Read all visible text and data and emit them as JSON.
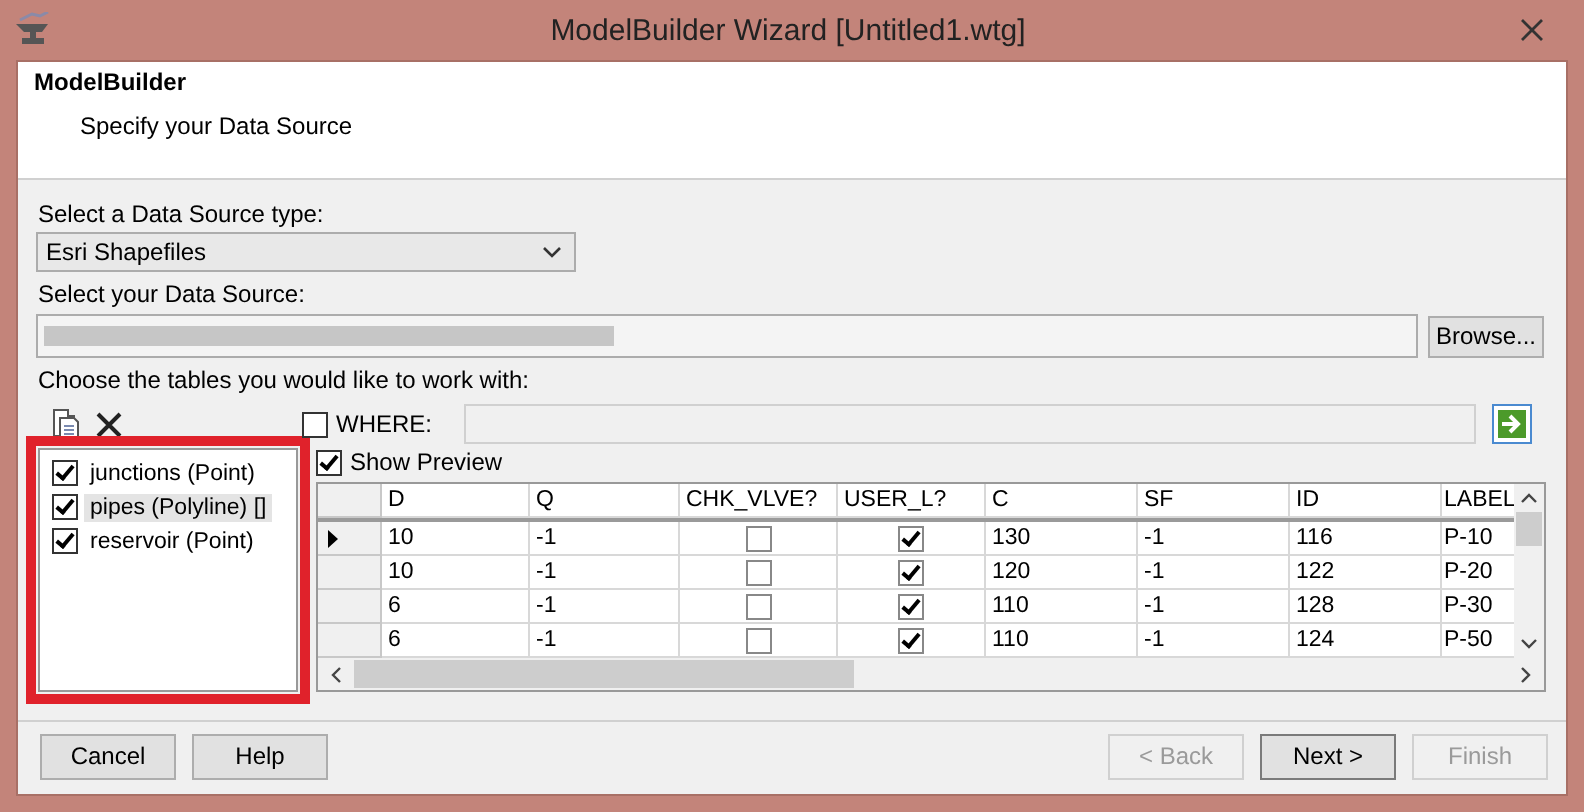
{
  "window": {
    "title": "ModelBuilder Wizard [Untitled1.wtg]"
  },
  "header": {
    "title": "ModelBuilder",
    "subtitle": "Specify your Data Source"
  },
  "source_type": {
    "label": "Select a Data Source type:",
    "value": "Esri Shapefiles"
  },
  "source": {
    "label": "Select your Data Source:",
    "browse": "Browse..."
  },
  "tables_label": "Choose the tables you would like to work with:",
  "where": {
    "label": "WHERE:",
    "checked": false
  },
  "tables": [
    {
      "label": "junctions (Point)",
      "checked": true,
      "selected": false
    },
    {
      "label": "pipes (Polyline) []",
      "checked": true,
      "selected": true
    },
    {
      "label": "reservoir (Point)",
      "checked": true,
      "selected": false
    }
  ],
  "show_preview": {
    "label": "Show Preview",
    "checked": true
  },
  "grid": {
    "columns": [
      {
        "label": "D",
        "kind": "text"
      },
      {
        "label": "Q",
        "kind": "text"
      },
      {
        "label": "CHK_VLVE?",
        "kind": "check"
      },
      {
        "label": "USER_L?",
        "kind": "check"
      },
      {
        "label": "C",
        "kind": "text"
      },
      {
        "label": "SF",
        "kind": "text"
      },
      {
        "label": "ID",
        "kind": "text"
      },
      {
        "label": "LABEL",
        "kind": "text"
      }
    ],
    "rows": [
      {
        "current": true,
        "cells": [
          "10",
          "-1",
          false,
          true,
          "130",
          "-1",
          "116",
          "P-10"
        ]
      },
      {
        "current": false,
        "cells": [
          "10",
          "-1",
          false,
          true,
          "120",
          "-1",
          "122",
          "P-20"
        ]
      },
      {
        "current": false,
        "cells": [
          "6",
          "-1",
          false,
          true,
          "110",
          "-1",
          "128",
          "P-30"
        ]
      },
      {
        "current": false,
        "cells": [
          "6",
          "-1",
          false,
          true,
          "110",
          "-1",
          "124",
          "P-50"
        ]
      }
    ]
  },
  "buttons": [
    {
      "label": "Cancel",
      "disabled": false
    },
    {
      "label": "Help",
      "disabled": false
    },
    {
      "label": "< Back",
      "disabled": true
    },
    {
      "label": "Next >",
      "disabled": false
    },
    {
      "label": "Finish",
      "disabled": true
    }
  ]
}
